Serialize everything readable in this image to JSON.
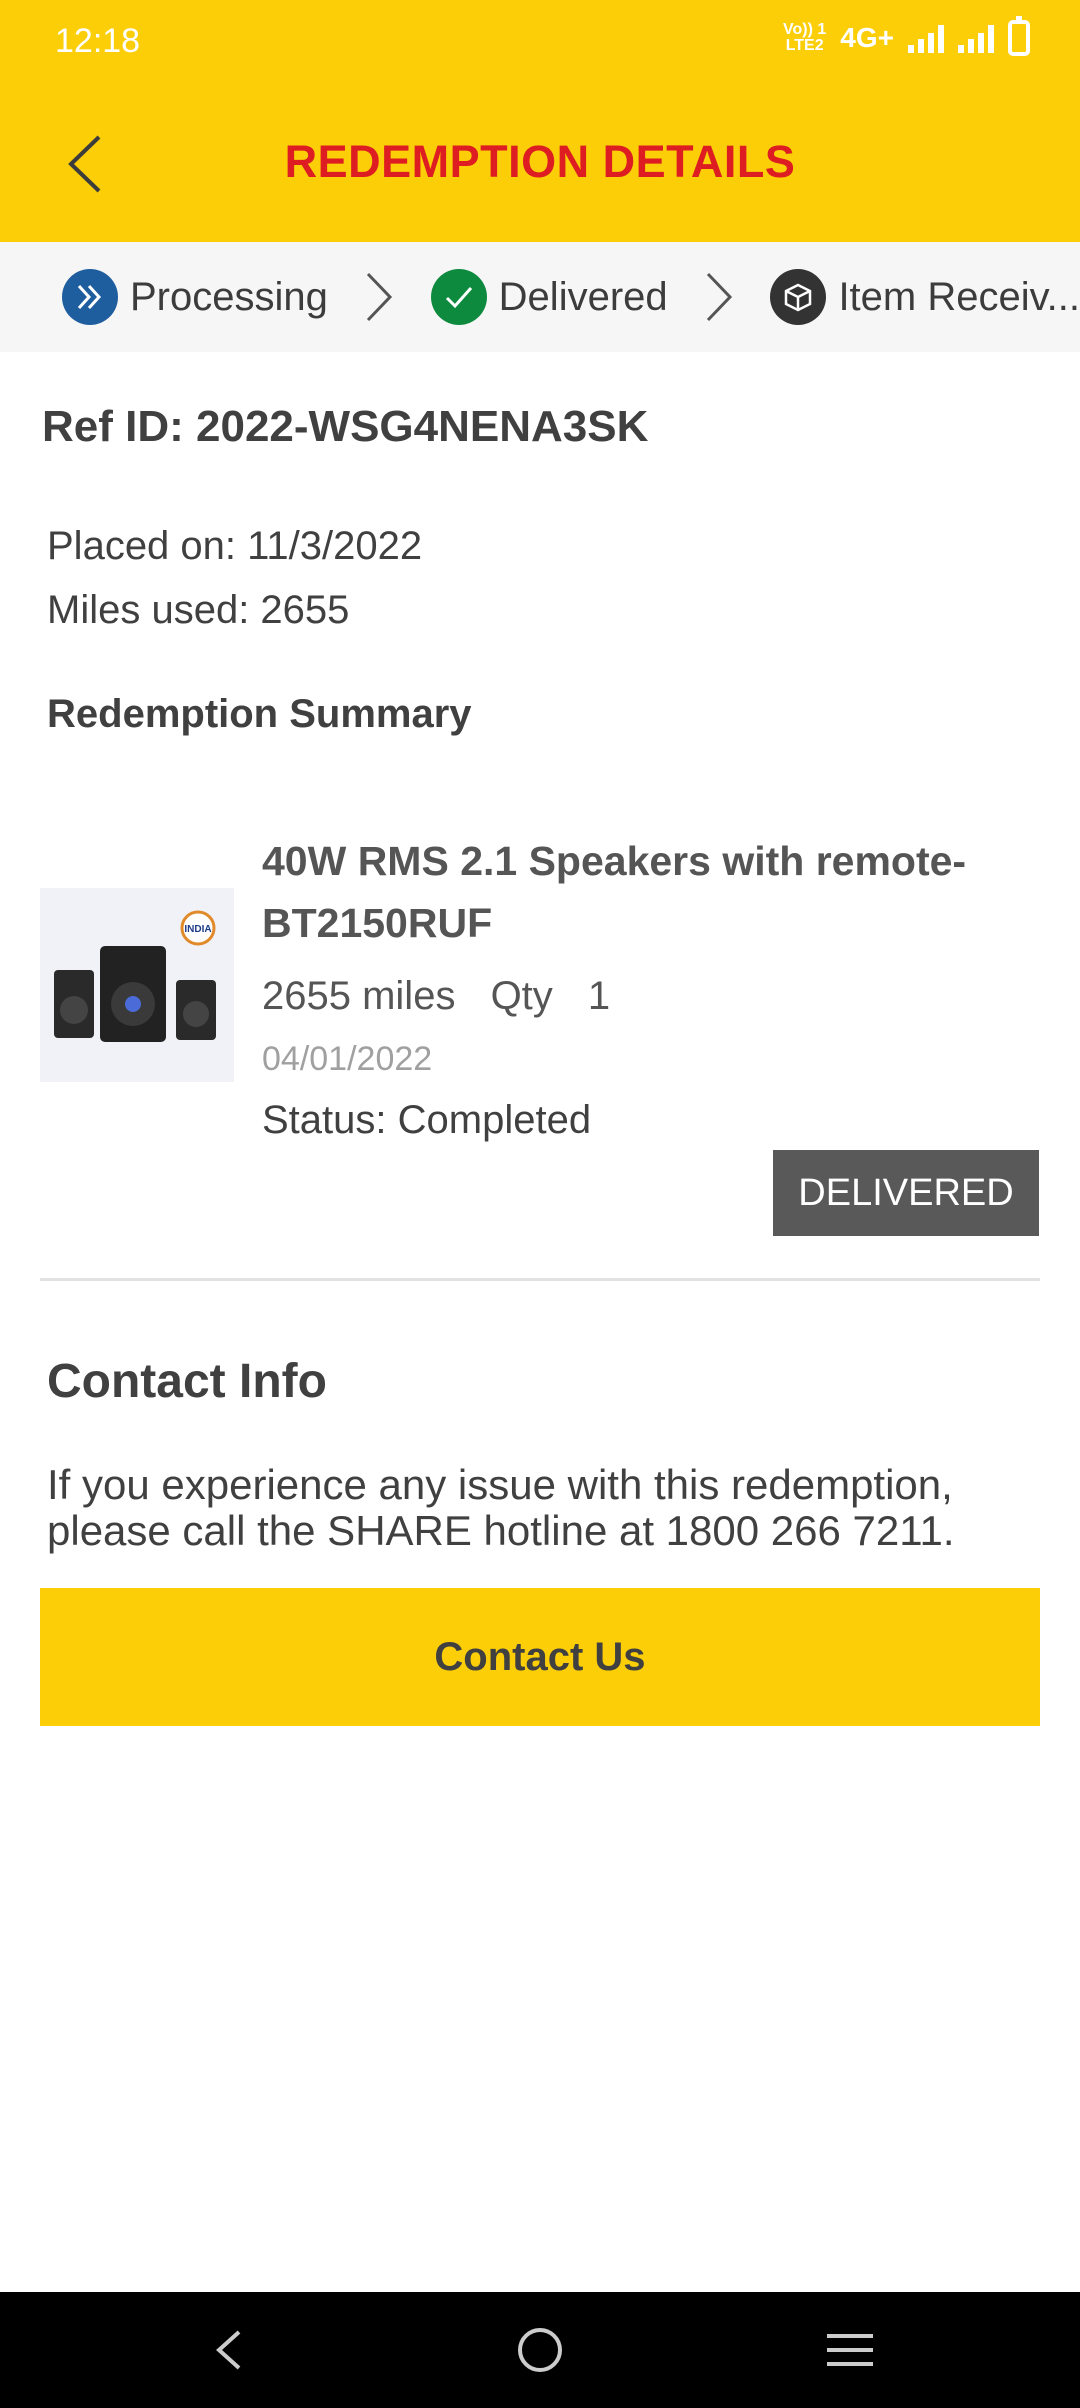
{
  "status_bar": {
    "time": "12:18",
    "network_label_top": "Vo)) 1",
    "network_label_bottom": "LTE2",
    "network_type": "4G+"
  },
  "header": {
    "title": "REDEMPTION DETAILS",
    "back_icon": "chevron-left-icon"
  },
  "steps": [
    {
      "label": "Processing",
      "icon": "double-chevron-right-icon",
      "color": "#1f5e9e"
    },
    {
      "label": "Delivered",
      "icon": "check-icon",
      "color": "#0e8a3e"
    },
    {
      "label": "Item Receiv...",
      "icon": "package-icon",
      "color": "#333333"
    }
  ],
  "order": {
    "ref_id": "Ref ID: 2022-WSG4NENA3SK",
    "placed_on": "Placed on: 11/3/2022",
    "miles_used": "Miles used: 2655"
  },
  "summary": {
    "title": "Redemption Summary",
    "item": {
      "name": "40W RMS 2.1 Speakers with remote-BT2150RUF",
      "miles": "2655 miles",
      "qty_label": "Qty",
      "qty": "1",
      "date": "04/01/2022",
      "status": "Status: Completed",
      "badge": "DELIVERED",
      "image_badge": "INDIA"
    }
  },
  "contact": {
    "title": "Contact Info",
    "text": "If you experience any issue with this redemption, please call the SHARE hotline at 1800 266 7211.",
    "button_label": "Contact Us"
  },
  "colors": {
    "brand_yellow": "#fbce07",
    "brand_red": "#dd1d21",
    "badge_grey": "#595959"
  }
}
